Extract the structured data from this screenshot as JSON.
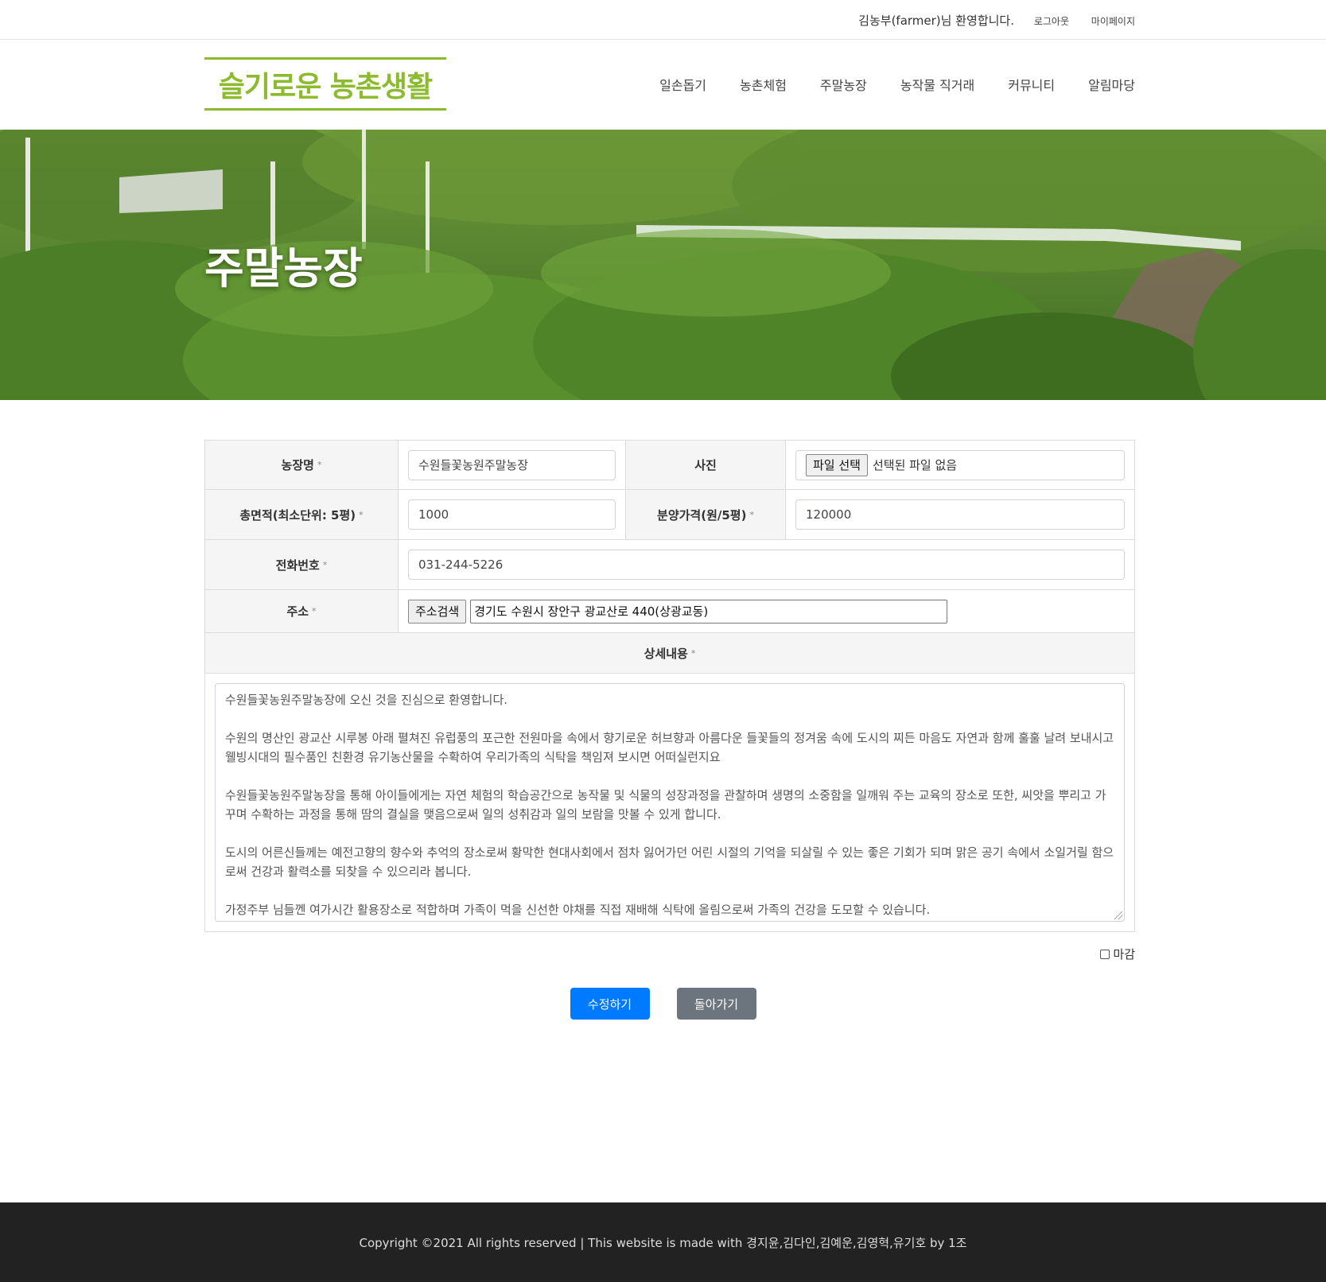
{
  "topbar": {
    "welcome": "김농부(farmer)님 환영합니다.",
    "logout": "로그아웃",
    "mypage": "마이페이지"
  },
  "header": {
    "logo": "슬기로운 농촌생활",
    "nav": [
      "일손돕기",
      "농촌체험",
      "주말농장",
      "농작물 직거래",
      "커뮤니티",
      "알림마당"
    ]
  },
  "hero": {
    "title": "주말농장"
  },
  "form": {
    "required_mark": "*",
    "farm_name_label": "농장명",
    "farm_name_value": "수원들꽃농원주말농장",
    "photo_label": "사진",
    "file_button": "파일 선택",
    "file_status": "선택된 파일 없음",
    "area_label": "총면적(최소단위: 5평)",
    "area_value": "1000",
    "price_label": "분양가격(원/5평)",
    "price_value": "120000",
    "phone_label": "전화번호",
    "phone_value": "031-244-5226",
    "address_label": "주소",
    "address_button": "주소검색",
    "address_value": "경기도 수원시 장안구 광교산로 440(상광교동)",
    "detail_label": "상세내용",
    "detail_paragraphs": [
      "수원들꽃농원주말농장에 오신 것을 진심으로 환영합니다.",
      "수원의 명산인 광교산 시루봉 아래 펼쳐진 유럽풍의 포근한 전원마을 속에서 향기로운 허브향과 아름다운 들꽃들의 정겨움 속에 도시의 찌든 마음도 자연과 함께 훌훌 날려 보내시고 웰빙시대의 필수품인 친환경 유기농산물을 수확하여 우리가족의 식탁을 책임져 보시면 어떠실런지요",
      "수원들꽃농원주말농장을 통해 아이들에게는 자연 체험의 학습공간으로 농작물 및 식물의 성장과정을 관찰하며 생명의 소중함을 일깨워 주는 교육의 장소로 또한, 씨앗을 뿌리고 가꾸며 수확하는 과정을 통해 땀의 결실을 맺음으로써 일의 성취감과 일의 보람을 맛볼 수 있게 합니다.",
      "도시의 어른신들께는 예전고향의 향수와 추억의 장소로써 황막한 현대사회에서 점차 잃어가던 어린 시절의 기억을 되살릴 수 있는 좋은 기회가 되며 맑은 공기 속에서 소일거릴 함으로써 건강과 활력소를 되찾을 수 있으리라 봅니다.",
      "가정주부 님들껜 여가시간 활용장소로 적합하며 가족이 먹을 신선한 야채를 직접 재배해 식탁에 올림으로써 가족의 건강을 도모할 수 있습니다."
    ],
    "closing_label": "마감",
    "submit_label": "수정하기",
    "back_label": "돌아가기"
  },
  "footer": {
    "text": "Copyright ©2021 All rights reserved | This website is made with 경지윤,김다인,김예운,김영혁,유기호 by 1조"
  },
  "colors": {
    "brand_green": "#8cbb2f",
    "primary": "#007bff",
    "secondary": "#6c757d",
    "footer_bg": "#222222"
  }
}
